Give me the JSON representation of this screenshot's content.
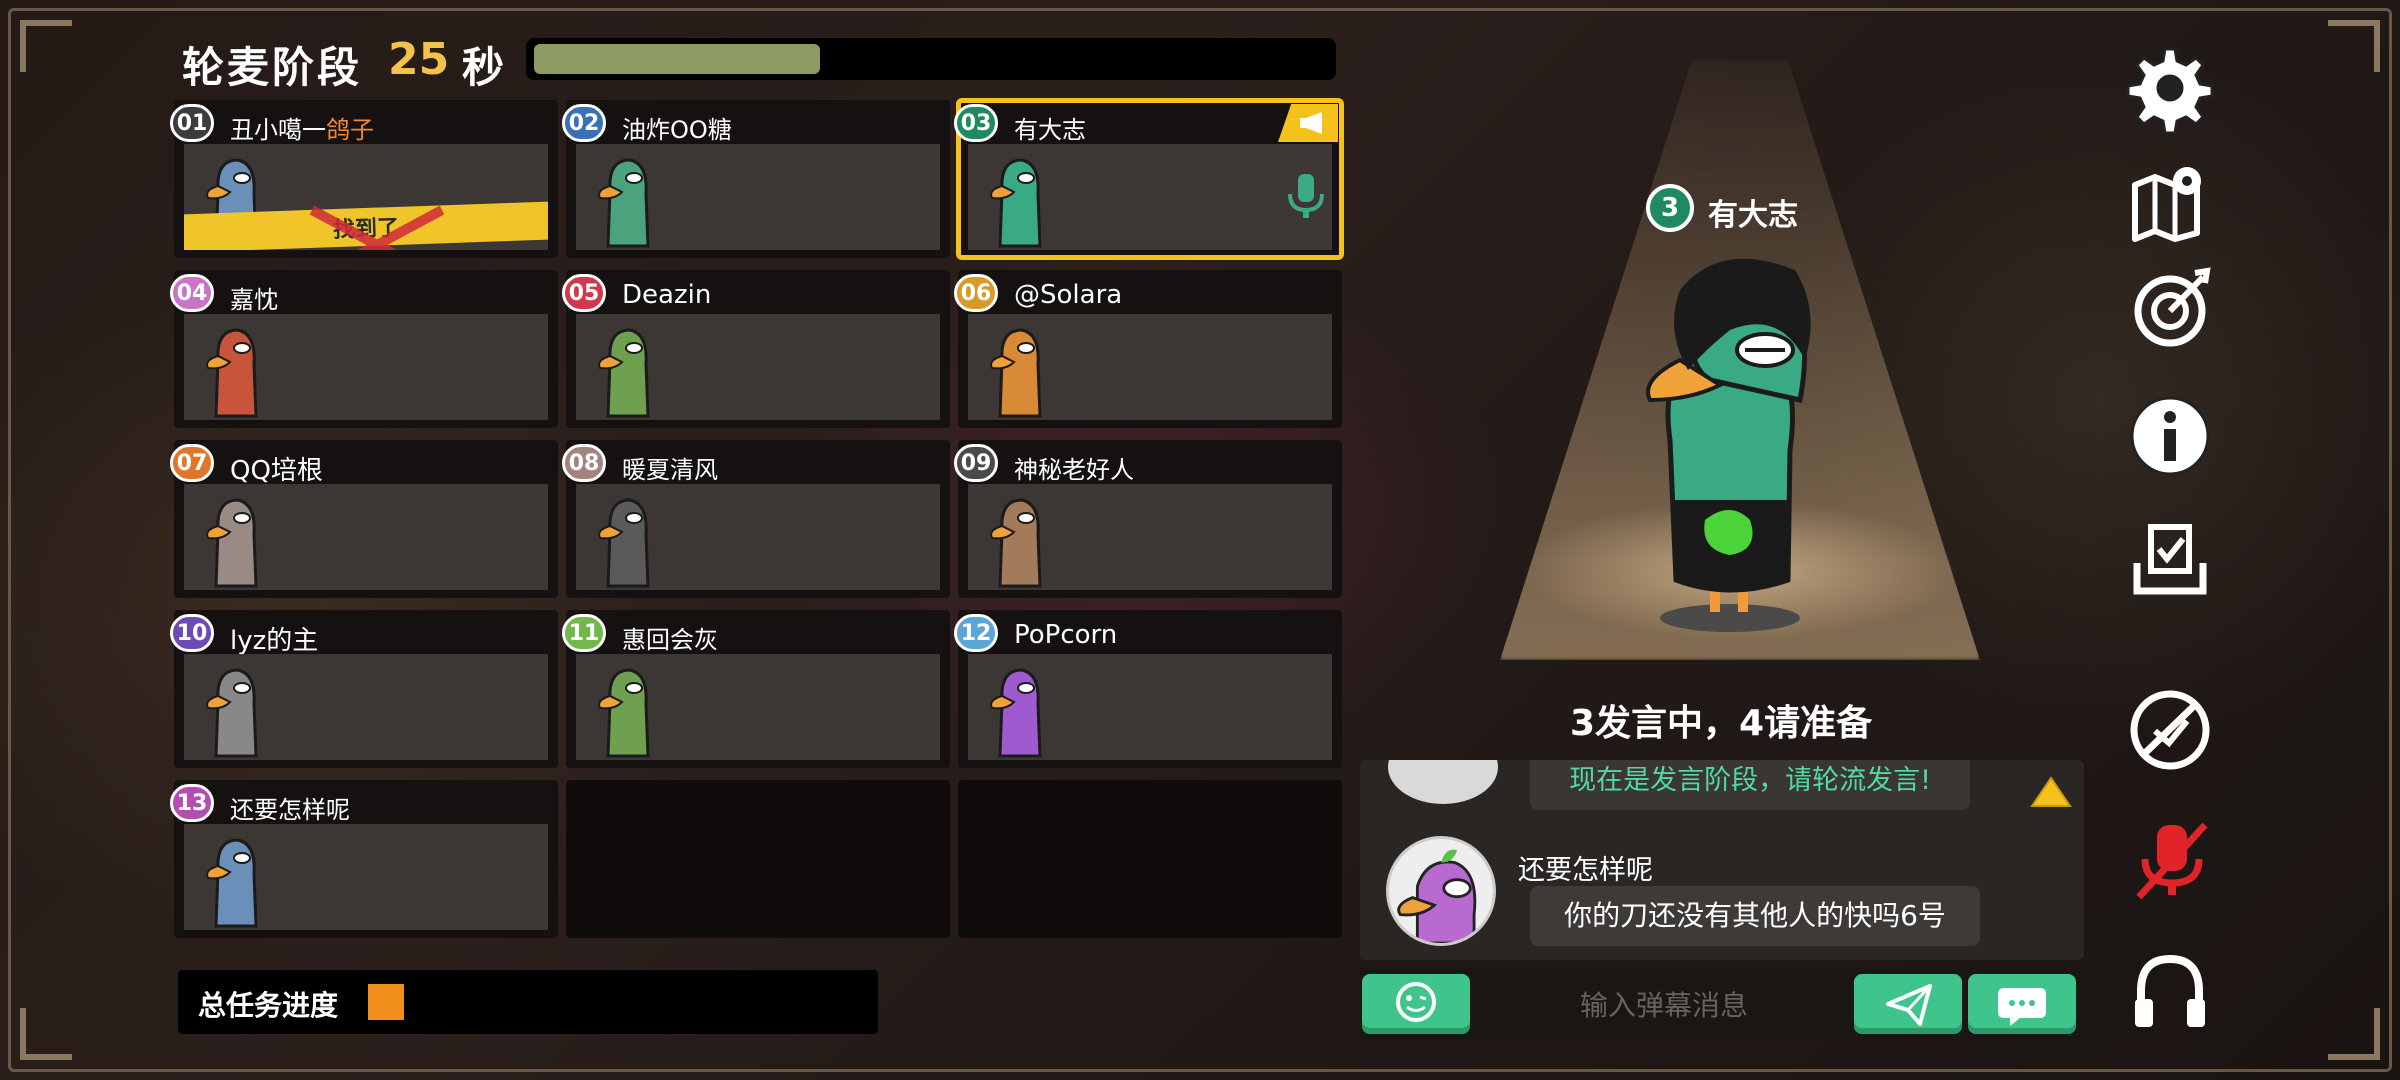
{
  "header": {
    "phase_label": "轮麦阶段",
    "seconds": "25",
    "seconds_unit": "秒",
    "timer_fraction": 0.36
  },
  "players": [
    {
      "num": "01",
      "name": "丑小噶一",
      "name_accent": "鸽子",
      "badge_color": "#3c3c3c",
      "bg": "dead",
      "status_text": "找到了"
    },
    {
      "num": "02",
      "name": "油炸OO糖",
      "badge_color": "#3b6fb6",
      "bg": "plain"
    },
    {
      "num": "03",
      "name": "有大志",
      "badge_color": "#1f8a5e",
      "bg": "fire",
      "speaking": true
    },
    {
      "num": "04",
      "name": "嘉忱",
      "badge_color": "#c973c9",
      "bg": "clouds"
    },
    {
      "num": "05",
      "name": "Deazin",
      "badge_color": "#d2384c",
      "bg": "plain"
    },
    {
      "num": "06",
      "name": "@Solara",
      "badge_color": "#d89b2a",
      "bg": "plain"
    },
    {
      "num": "07",
      "name": "QQ培根",
      "badge_color": "#e0762b",
      "bg": "plain"
    },
    {
      "num": "08",
      "name": "暖夏清风",
      "badge_color": "#a4837f",
      "bg": "street"
    },
    {
      "num": "09",
      "name": "神秘老好人",
      "badge_color": "#4a4a4a",
      "bg": "plain"
    },
    {
      "num": "10",
      "name": "lyz的主",
      "badge_color": "#6c4bb3",
      "bg": "plain"
    },
    {
      "num": "11",
      "name": "惠回会灰",
      "badge_color": "#72b84a",
      "bg": "plain"
    },
    {
      "num": "12",
      "name": "PoPcorn",
      "badge_color": "#5aa6d6",
      "bg": "plain"
    },
    {
      "num": "13",
      "name": "还要怎样呢",
      "badge_color": "#b04fb0",
      "bg": "fire2"
    }
  ],
  "task_progress": {
    "label": "总任务进度",
    "fraction": 0.05
  },
  "speaker": {
    "number": "3",
    "name": "有大志"
  },
  "announcement": "3发言中，4请准备",
  "chat": {
    "system_message": "现在是发言阶段，请轮流发言!",
    "messages": [
      {
        "user": "还要怎样呢",
        "text": "你的刀还没有其他人的快吗6号"
      }
    ],
    "input_placeholder": "输入弹幕消息"
  },
  "toolbar": [
    "gear-icon",
    "map-icon",
    "target-icon",
    "info-icon",
    "tasks-icon",
    "visibility-off-icon",
    "mic-off-icon",
    "headphones-icon"
  ],
  "colors": {
    "accent_green": "#3fc58c",
    "timer_fill": "#8c9b62",
    "highlight_yellow": "#f5c21b",
    "muted_red": "#e0242a"
  }
}
